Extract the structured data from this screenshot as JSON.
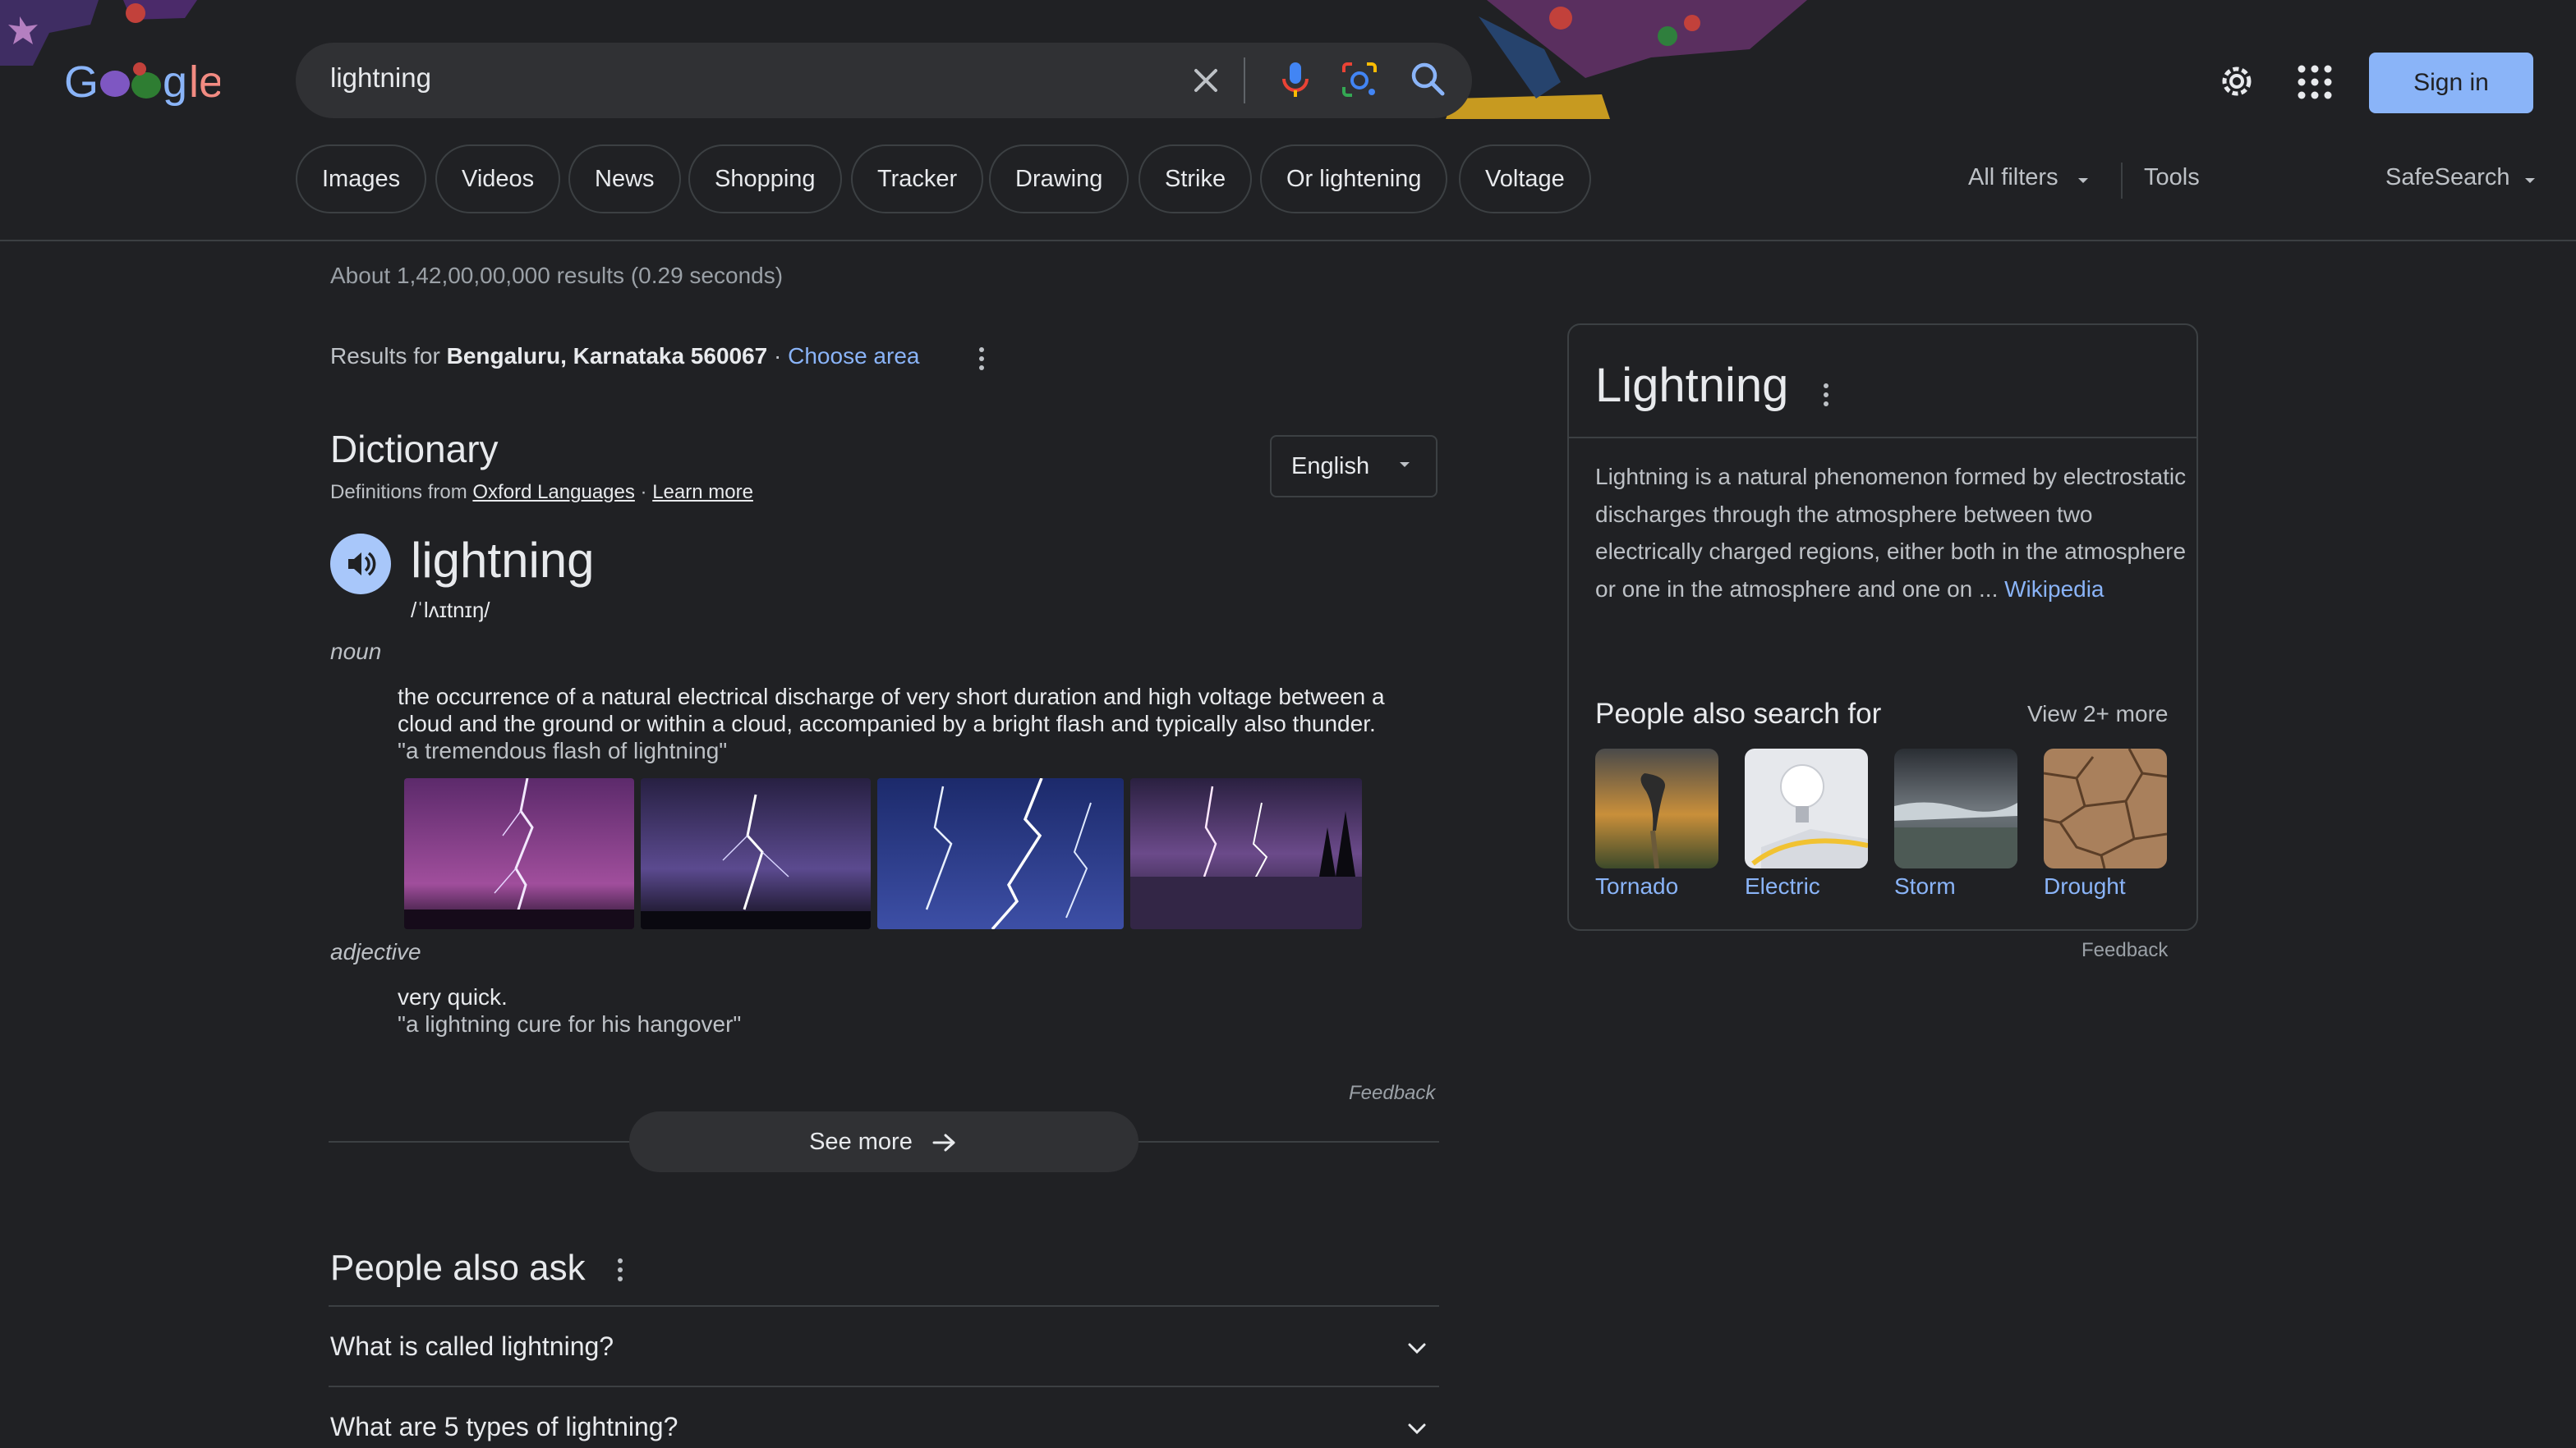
{
  "search": {
    "query": "lightning"
  },
  "header": {
    "sign_in": "Sign in"
  },
  "chips": [
    "Images",
    "Videos",
    "News",
    "Shopping",
    "Tracker",
    "Drawing",
    "Strike",
    "Or lightening",
    "Voltage"
  ],
  "filters": {
    "all_filters": "All filters",
    "tools": "Tools",
    "safesearch": "SafeSearch"
  },
  "results": {
    "stats": "About 1,42,00,00,000 results (0.29 seconds)",
    "location_prefix": "Results for ",
    "location": "Bengaluru, Karnataka 560067",
    "location_sep": " · ",
    "choose_area": "Choose area"
  },
  "dictionary": {
    "title": "Dictionary",
    "source_prefix": "Definitions from ",
    "source_name": "Oxford Languages",
    "source_sep": " · ",
    "learn_more": "Learn more",
    "language": "English",
    "word": "lightning",
    "phonetic": "/ˈlʌɪtnɪŋ/",
    "noun_label": "noun",
    "noun_definition": "the occurrence of a natural electrical discharge of very short duration and high voltage between a cloud and the ground or within a cloud, accompanied by a bright flash and typically also thunder.",
    "noun_example": "\"a tremendous flash of lightning\"",
    "adjective_label": "adjective",
    "adjective_definition": "very quick.",
    "adjective_example": "\"a lightning cure for his hangover\"",
    "feedback": "Feedback",
    "see_more": "See more"
  },
  "people_also_ask": {
    "title": "People also ask",
    "questions": [
      "What is called lightning?",
      "What are 5 types of lightning?"
    ]
  },
  "knowledge_panel": {
    "title": "Lightning",
    "description": "Lightning is a natural phenomenon formed by electrostatic discharges through the atmosphere between two electrically charged regions, either both in the atmosphere or one in the atmosphere and one on ... ",
    "source": "Wikipedia",
    "also_search_title": "People also search for",
    "view_more": "View 2+ more",
    "related": [
      "Tornado",
      "Electric",
      "Storm",
      "Drought"
    ],
    "feedback": "Feedback"
  },
  "colors": {
    "background": "#202124",
    "surface": "#303134",
    "link": "#8ab4f8",
    "accent_button": "#8ab4f8"
  }
}
